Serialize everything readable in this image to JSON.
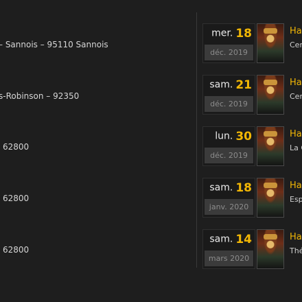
{
  "locations": [
    {
      "text": "– Sannois – 95110 Sannois"
    },
    {
      "text": "s-Robinson – 92350"
    },
    {
      "text": "62800"
    },
    {
      "text": "62800"
    },
    {
      "text": "62800"
    }
  ],
  "events": [
    {
      "day_name": "mer.",
      "day_num": "18",
      "month": "déc. 2019",
      "title": "Ha",
      "venue": "Cer"
    },
    {
      "day_name": "sam.",
      "day_num": "21",
      "month": "déc. 2019",
      "title": "Ha",
      "venue": "Cer"
    },
    {
      "day_name": "lun.",
      "day_num": "30",
      "month": "déc. 2019",
      "title": "Ha",
      "venue": "La C"
    },
    {
      "day_name": "sam.",
      "day_num": "18",
      "month": "janv. 2020",
      "title": "Ha",
      "venue": "Esp"
    },
    {
      "day_name": "sam.",
      "day_num": "14",
      "month": "mars 2020",
      "title": "Ha",
      "venue": "Thé"
    }
  ],
  "colors": {
    "background": "#1e1e1e",
    "accent": "#f2b705",
    "date_box": "#1a1a1a",
    "month_band": "#3b3b3b"
  }
}
